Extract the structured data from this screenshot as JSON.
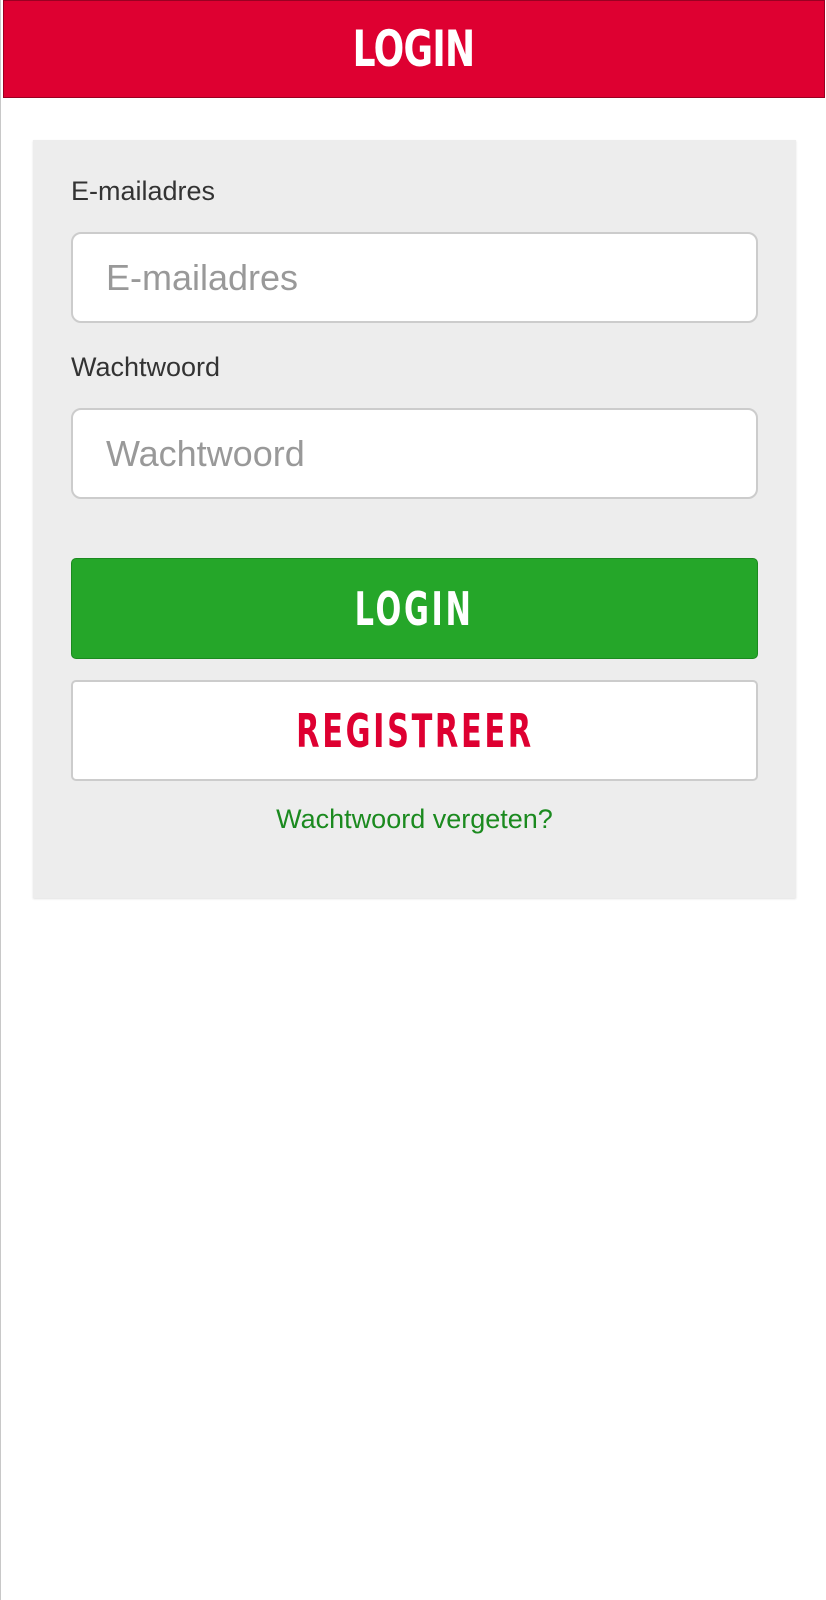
{
  "header": {
    "title": "LOGIN"
  },
  "form": {
    "email": {
      "label": "E-mailadres",
      "placeholder": "E-mailadres",
      "value": ""
    },
    "password": {
      "label": "Wachtwoord",
      "placeholder": "Wachtwoord",
      "value": ""
    },
    "login_button": "LOGIN",
    "register_button": "REGISTREER",
    "forgot_link": "Wachtwoord vergeten?"
  },
  "colors": {
    "brand_red": "#de0031",
    "login_green": "#25a629",
    "link_green": "#1b8a1f",
    "panel_gray": "#ededed"
  }
}
